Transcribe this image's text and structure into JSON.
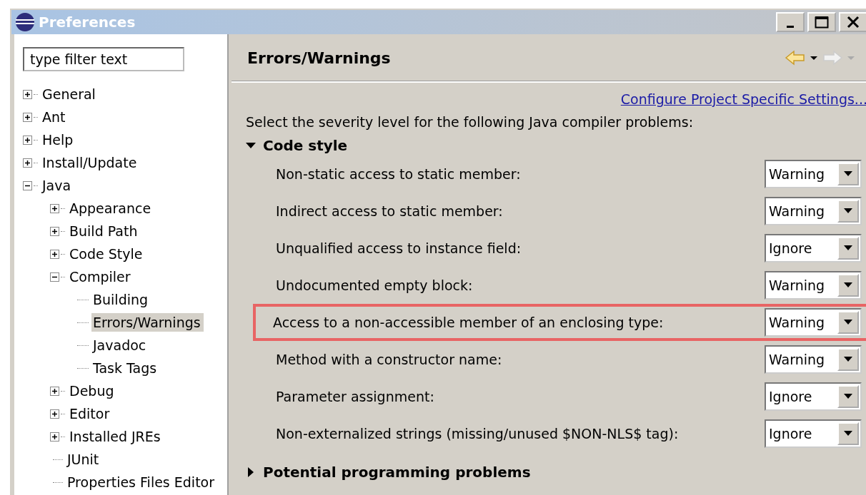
{
  "window": {
    "title": "Preferences"
  },
  "sidebar": {
    "filter": {
      "placeholder": "type filter text"
    },
    "tree": [
      {
        "kind": "branch",
        "label": "General",
        "expanded": false,
        "selected": false
      },
      {
        "kind": "branch",
        "label": "Ant",
        "expanded": false,
        "selected": false
      },
      {
        "kind": "branch",
        "label": "Help",
        "expanded": false,
        "selected": false
      },
      {
        "kind": "branch",
        "label": "Install/Update",
        "expanded": false,
        "selected": false
      },
      {
        "kind": "branch",
        "label": "Java",
        "expanded": true,
        "selected": false,
        "children": [
          {
            "kind": "branch",
            "label": "Appearance",
            "expanded": false,
            "selected": false
          },
          {
            "kind": "branch",
            "label": "Build Path",
            "expanded": false,
            "selected": false
          },
          {
            "kind": "branch",
            "label": "Code Style",
            "expanded": false,
            "selected": false
          },
          {
            "kind": "branch",
            "label": "Compiler",
            "expanded": true,
            "selected": false,
            "children": [
              {
                "kind": "leaf",
                "label": "Building",
                "selected": false
              },
              {
                "kind": "leaf",
                "label": "Errors/Warnings",
                "selected": true
              },
              {
                "kind": "leaf",
                "label": "Javadoc",
                "selected": false
              },
              {
                "kind": "leaf",
                "label": "Task Tags",
                "selected": false
              }
            ]
          },
          {
            "kind": "branch",
            "label": "Debug",
            "expanded": false,
            "selected": false
          },
          {
            "kind": "branch",
            "label": "Editor",
            "expanded": false,
            "selected": false
          },
          {
            "kind": "branch",
            "label": "Installed JREs",
            "expanded": false,
            "selected": false
          },
          {
            "kind": "leaf",
            "label": "JUnit",
            "selected": false
          },
          {
            "kind": "leaf",
            "label": "Properties Files Editor",
            "selected": false
          }
        ]
      }
    ]
  },
  "page": {
    "title": "Errors/Warnings",
    "link": "Configure Project Specific Settings...",
    "intro": "Select the severity level for the following Java compiler problems:",
    "sections": [
      {
        "title": "Code style",
        "expanded": true,
        "rows": [
          {
            "label": "Non-static access to static member:",
            "value": "Warning",
            "highlighted": false
          },
          {
            "label": "Indirect access to static member:",
            "value": "Warning",
            "highlighted": false
          },
          {
            "label": "Unqualified access to instance field:",
            "value": "Ignore",
            "highlighted": false
          },
          {
            "label": "Undocumented empty block:",
            "value": "Warning",
            "highlighted": false
          },
          {
            "label": "Access to a non-accessible member of an enclosing type:",
            "value": "Warning",
            "highlighted": true
          },
          {
            "label": "Method with a constructor name:",
            "value": "Warning",
            "highlighted": false
          },
          {
            "label": "Parameter assignment:",
            "value": "Ignore",
            "highlighted": false
          },
          {
            "label": "Non-externalized strings (missing/unused $NON-NLS$ tag):",
            "value": "Ignore",
            "highlighted": false
          }
        ]
      },
      {
        "title": "Potential programming problems",
        "expanded": false
      }
    ]
  }
}
